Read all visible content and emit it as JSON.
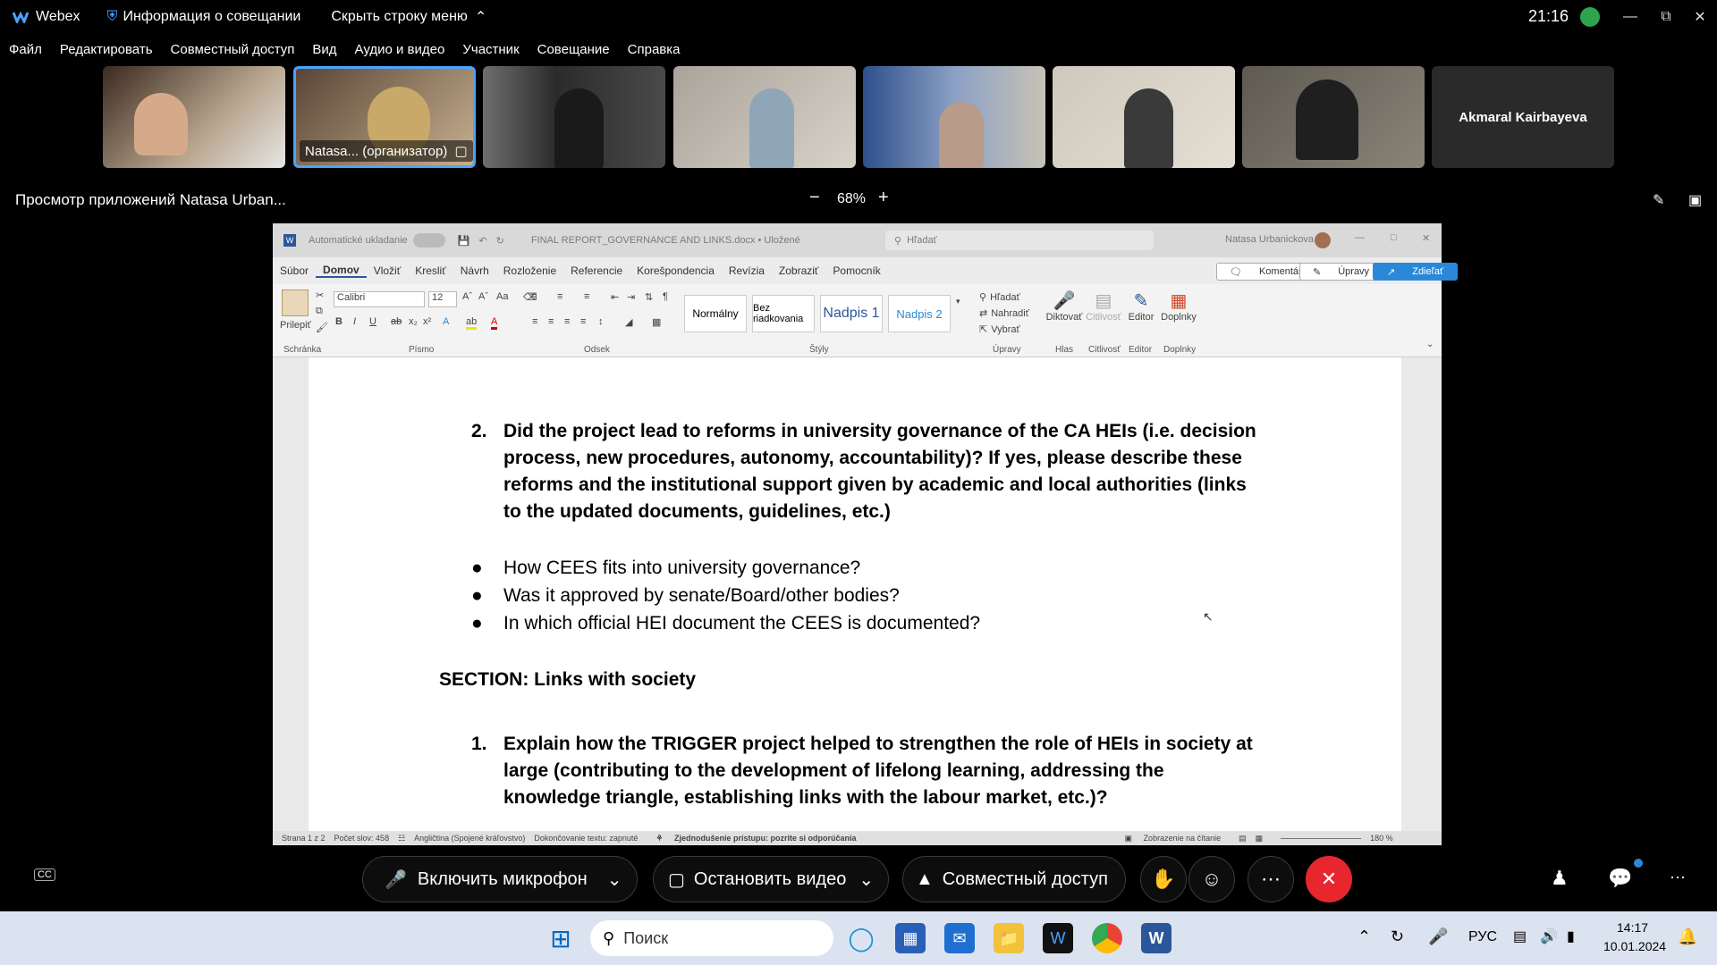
{
  "titlebar": {
    "app_name": "Webex",
    "meeting_info": "Информация о совещании",
    "hide_menu": "Скрыть строку меню",
    "clock": "21:16"
  },
  "menu": [
    "Файл",
    "Редактировать",
    "Совместный доступ",
    "Вид",
    "Аудио и видео",
    "Участник",
    "Совещание",
    "Справка"
  ],
  "participants": {
    "host_label": "Natasa... (организатор)",
    "name_only": "Akmaral Kairbayeva"
  },
  "share": {
    "viewing_label": "Просмотр приложений Natasa Urban...",
    "zoom": "68%"
  },
  "word": {
    "autosave": "Automatické ukladanie",
    "filename": "FINAL REPORT_GOVERNANCE AND LINKS.docx • Uložené",
    "search": "Hľadať",
    "user": "Natasa Urbanickova",
    "tabs": [
      "Súbor",
      "Domov",
      "Vložiť",
      "Kresliť",
      "Návrh",
      "Rozloženie",
      "Referencie",
      "Korešpondencia",
      "Revízia",
      "Zobraziť",
      "Pomocník"
    ],
    "comments_btn": "Komentáre",
    "edit_btn": "Úpravy",
    "share_btn": "Zdieľať",
    "font_name": "Calibri",
    "font_size": "12",
    "paste_label": "Prilepiť",
    "styles": [
      "Normálny",
      "Bez riadkovania",
      "Nadpis 1",
      "Nadpis 2"
    ],
    "find": "Hľadať",
    "replace": "Nahradiť",
    "select": "Vybrať",
    "dictate": "Diktovať",
    "sensitivity": "Citlivosť",
    "editor": "Editor",
    "addins": "Doplnky",
    "group_labels": [
      "Schránka",
      "Písmo",
      "Odsek",
      "Štýly",
      "Úpravy",
      "Hlas",
      "Citlivosť",
      "Editor",
      "Doplnky"
    ],
    "status": {
      "page": "Strana 1 z 2",
      "words": "Počet slov: 458",
      "language": "Angličtina (Spojené kráľovstvo)",
      "autocomplete": "Dokončovanie textu: zapnuté",
      "accessibility": "Zjednodušenie prístupu: pozrite si odporúčania",
      "reading": "Zobrazenie na čítanie",
      "zoom": "180 %"
    }
  },
  "document": {
    "q2_num": "2.",
    "q2_lines": [
      "Did the project lead to reforms in university governance of the CA HEIs (i.e. decision",
      "process, new procedures, autonomy, accountability)? If yes, please describe these",
      "reforms and the institutional support given by academic and local authorities (links",
      "to the updated documents, guidelines, etc.)"
    ],
    "bullets": [
      "How CEES fits into university governance?",
      "Was it approved by senate/Board/other bodies?",
      "In which official HEI document the CEES is documented?"
    ],
    "section": "SECTION: Links with society",
    "q1_num": "1.",
    "q1_lines": [
      "Explain how the TRIGGER project helped to strengthen the role of HEIs in society at",
      "large (contributing to the development of lifelong learning, addressing the",
      "knowledge triangle, establishing links with the labour market, etc.)?"
    ]
  },
  "controls": {
    "mic": "Включить микрофон",
    "video": "Остановить видео",
    "share": "Совместный доступ"
  },
  "taskbar": {
    "search_placeholder": "Поиск",
    "lang": "РУС",
    "time": "14:17",
    "date": "10.01.2024"
  },
  "colors": {
    "end_call": "#e8262e",
    "accent_blue": "#4aa3ff",
    "word_blue": "#2b579a"
  }
}
